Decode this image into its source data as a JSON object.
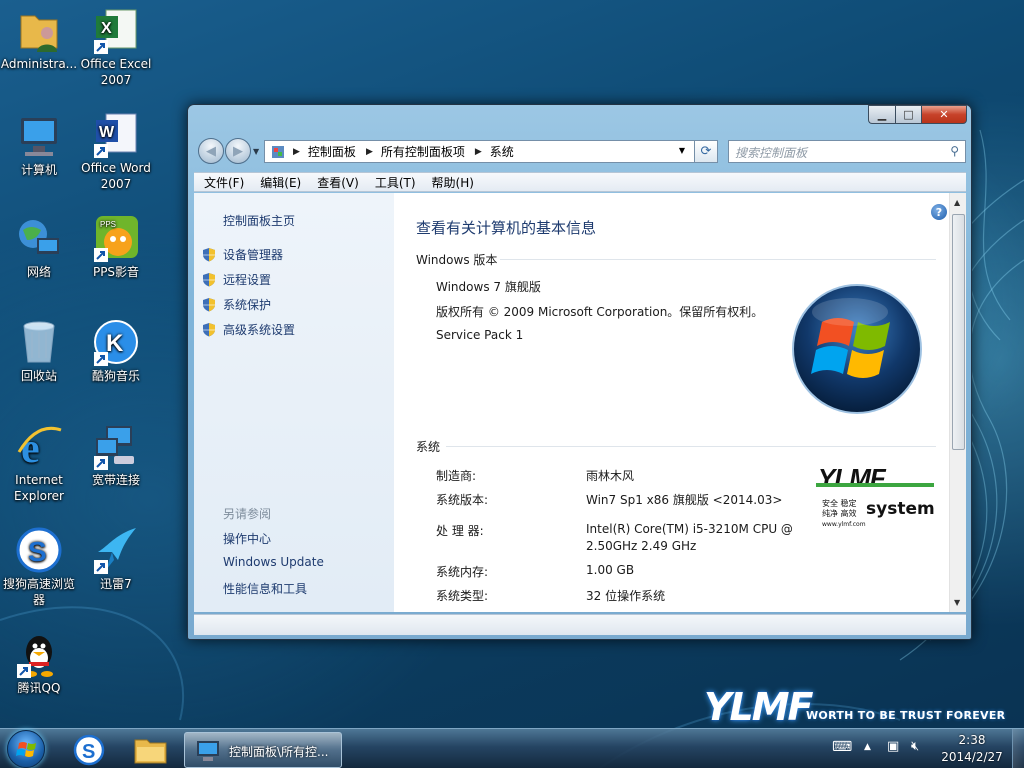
{
  "desktop": {
    "icons": [
      {
        "label": "Administra...",
        "name": "administrator-folder-icon"
      },
      {
        "label": "Office Excel 2007",
        "name": "office-excel-icon"
      },
      {
        "label": "计算机",
        "name": "computer-icon"
      },
      {
        "label": "Office Word 2007",
        "name": "office-word-icon"
      },
      {
        "label": "网络",
        "name": "network-icon"
      },
      {
        "label": "PPS影音",
        "name": "pps-player-icon"
      },
      {
        "label": "回收站",
        "name": "recycle-bin-icon"
      },
      {
        "label": "酷狗音乐",
        "name": "kugou-music-icon"
      },
      {
        "label": "Internet Explorer",
        "name": "internet-explorer-icon"
      },
      {
        "label": "宽带连接",
        "name": "broadband-connection-icon"
      },
      {
        "label": "搜狗高速浏览器",
        "name": "sogou-browser-icon"
      },
      {
        "label": "迅雷7",
        "name": "xunlei-icon"
      },
      {
        "label": "腾讯QQ",
        "name": "tencent-qq-icon"
      }
    ],
    "brand": {
      "mark": "YLMF",
      "tagline": "WORTH TO BE TRUST FOREVER"
    }
  },
  "window": {
    "breadcrumbs": [
      "控制面板",
      "所有控制面板项",
      "系统"
    ],
    "search_placeholder": "搜索控制面板",
    "menu": [
      "文件(F)",
      "编辑(E)",
      "查看(V)",
      "工具(T)",
      "帮助(H)"
    ],
    "left": {
      "home": "控制面板主页",
      "tasks": [
        "设备管理器",
        "远程设置",
        "系统保护",
        "高级系统设置"
      ],
      "see_also_title": "另请参阅",
      "see_also": [
        "操作中心",
        "Windows Update",
        "性能信息和工具"
      ]
    },
    "main": {
      "heading": "查看有关计算机的基本信息",
      "edition_section": "Windows 版本",
      "edition": "Windows 7 旗舰版",
      "copyright": "版权所有 © 2009 Microsoft Corporation。保留所有权利。",
      "service_pack": "Service Pack 1",
      "system_section": "系统",
      "rows": [
        {
          "label": "制造商:",
          "value": "雨林木风"
        },
        {
          "label": "系统版本:",
          "value": "Win7 Sp1 x86 旗舰版 <2014.03>"
        },
        {
          "label": "处 理 器:",
          "value": "Intel(R) Core(TM) i5-3210M CPU @",
          "value2": "2.50GHz   2.49 GHz"
        },
        {
          "label": "系统内存:",
          "value": "1.00 GB"
        },
        {
          "label": "系统类型:",
          "value": "32 位操作系统"
        }
      ],
      "oem_logo": {
        "mark": "YLMF",
        "line1": "安全 稳定",
        "line2": "纯净 高效",
        "url": "www.ylmf.com",
        "word": "system"
      }
    }
  },
  "taskbar": {
    "task_label": "控制面板\\所有控...",
    "time": "2:38",
    "date": "2014/2/27"
  }
}
